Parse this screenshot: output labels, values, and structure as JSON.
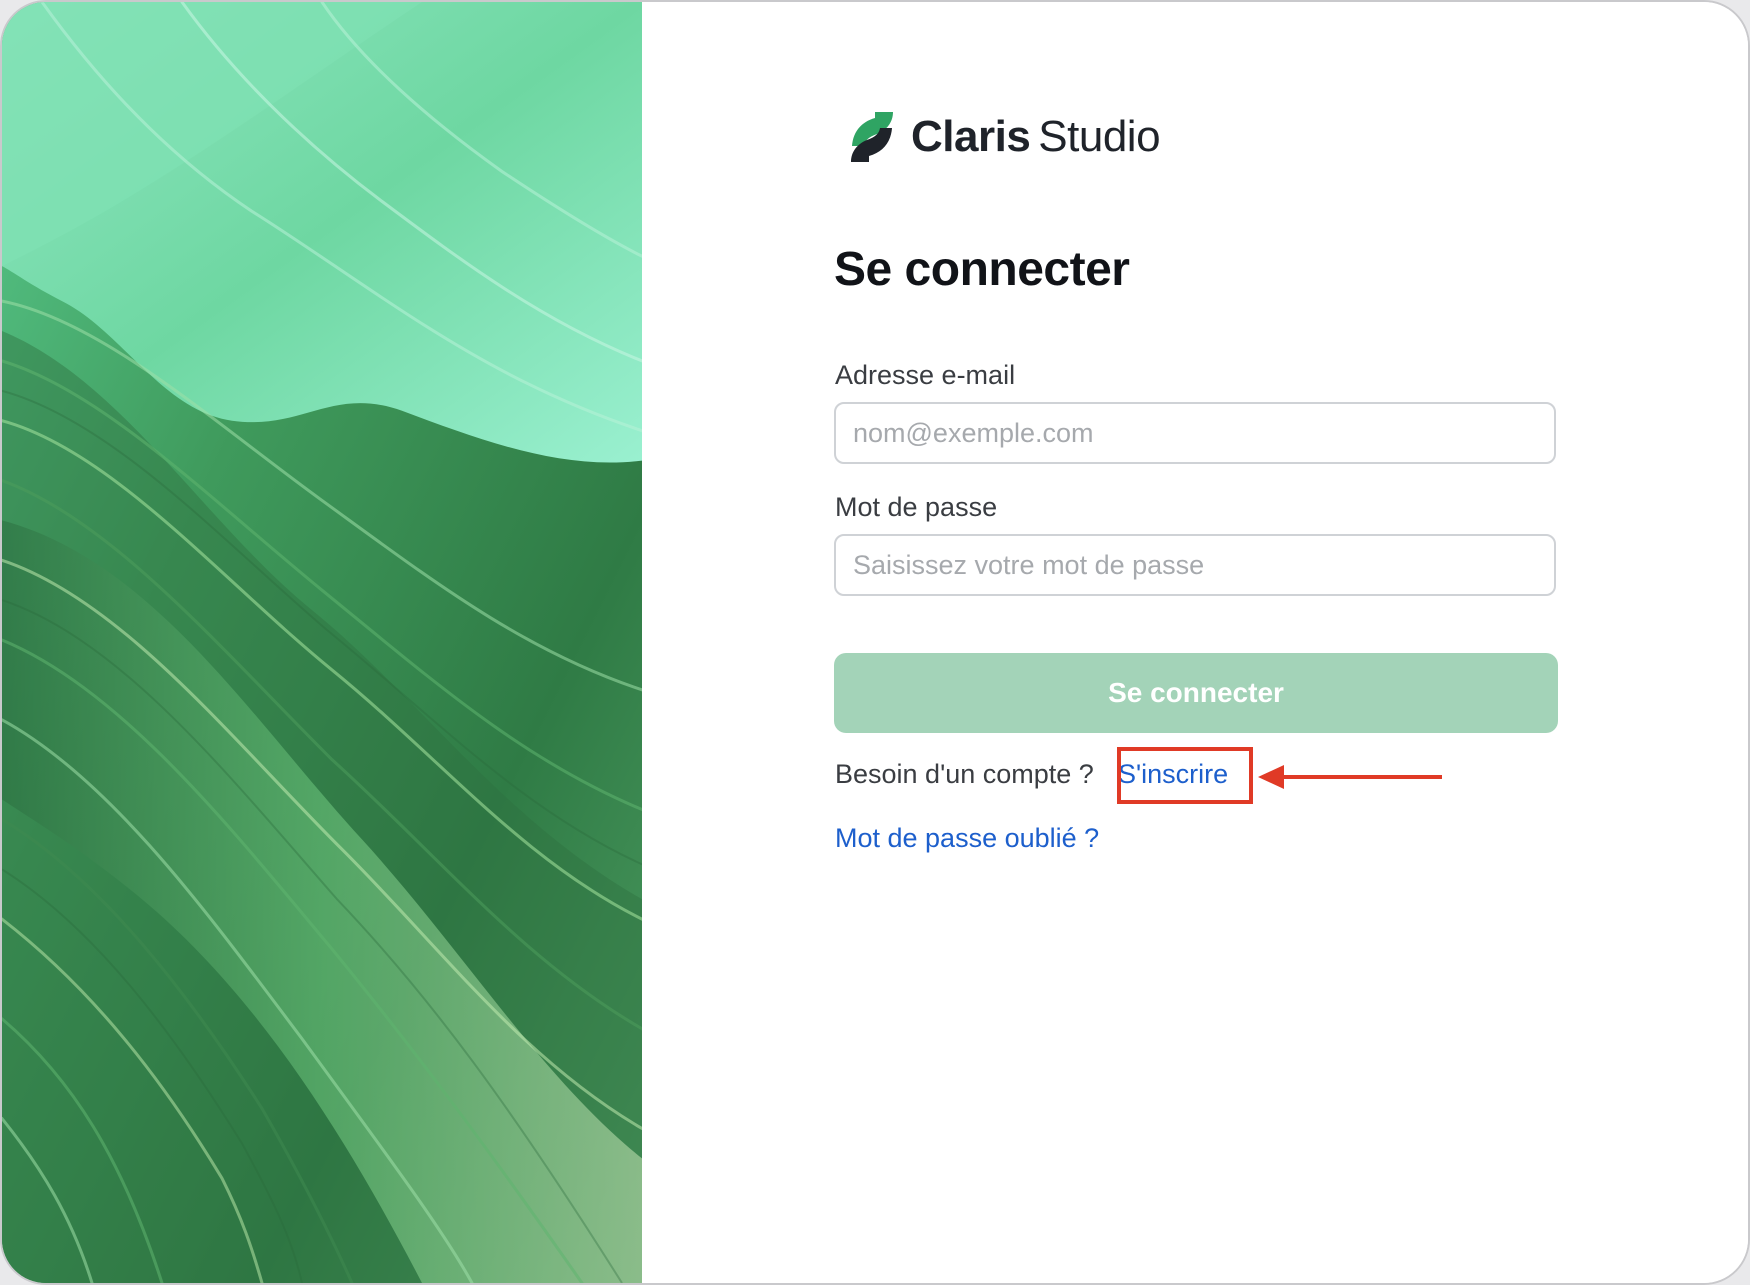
{
  "brand": {
    "name_bold": "Claris",
    "name_regular": "Studio",
    "logo_icon": "claris-logo-icon",
    "logo_colors": [
      "#1f232a",
      "#2fa463"
    ]
  },
  "hero": {
    "image": "green-wave-artwork",
    "colors": [
      "#2f7b45",
      "#58b771",
      "#8ee6c1"
    ]
  },
  "form": {
    "title": "Se connecter",
    "email": {
      "label": "Adresse e-mail",
      "placeholder": "nom@exemple.com",
      "value": ""
    },
    "password": {
      "label": "Mot de passe",
      "placeholder": "Saisissez votre mot de passe",
      "value": ""
    },
    "submit_label": "Se connecter",
    "submit_color": "#a3d3b8",
    "signup_prompt": "Besoin d'un compte ?",
    "signup_link": "S'inscrire",
    "forgot_link": "Mot de passe oublié ?",
    "link_color": "#1d5fcc"
  },
  "annotation": {
    "highlight_color": "#e03a26",
    "arrow_icon": "arrow-left-icon"
  }
}
